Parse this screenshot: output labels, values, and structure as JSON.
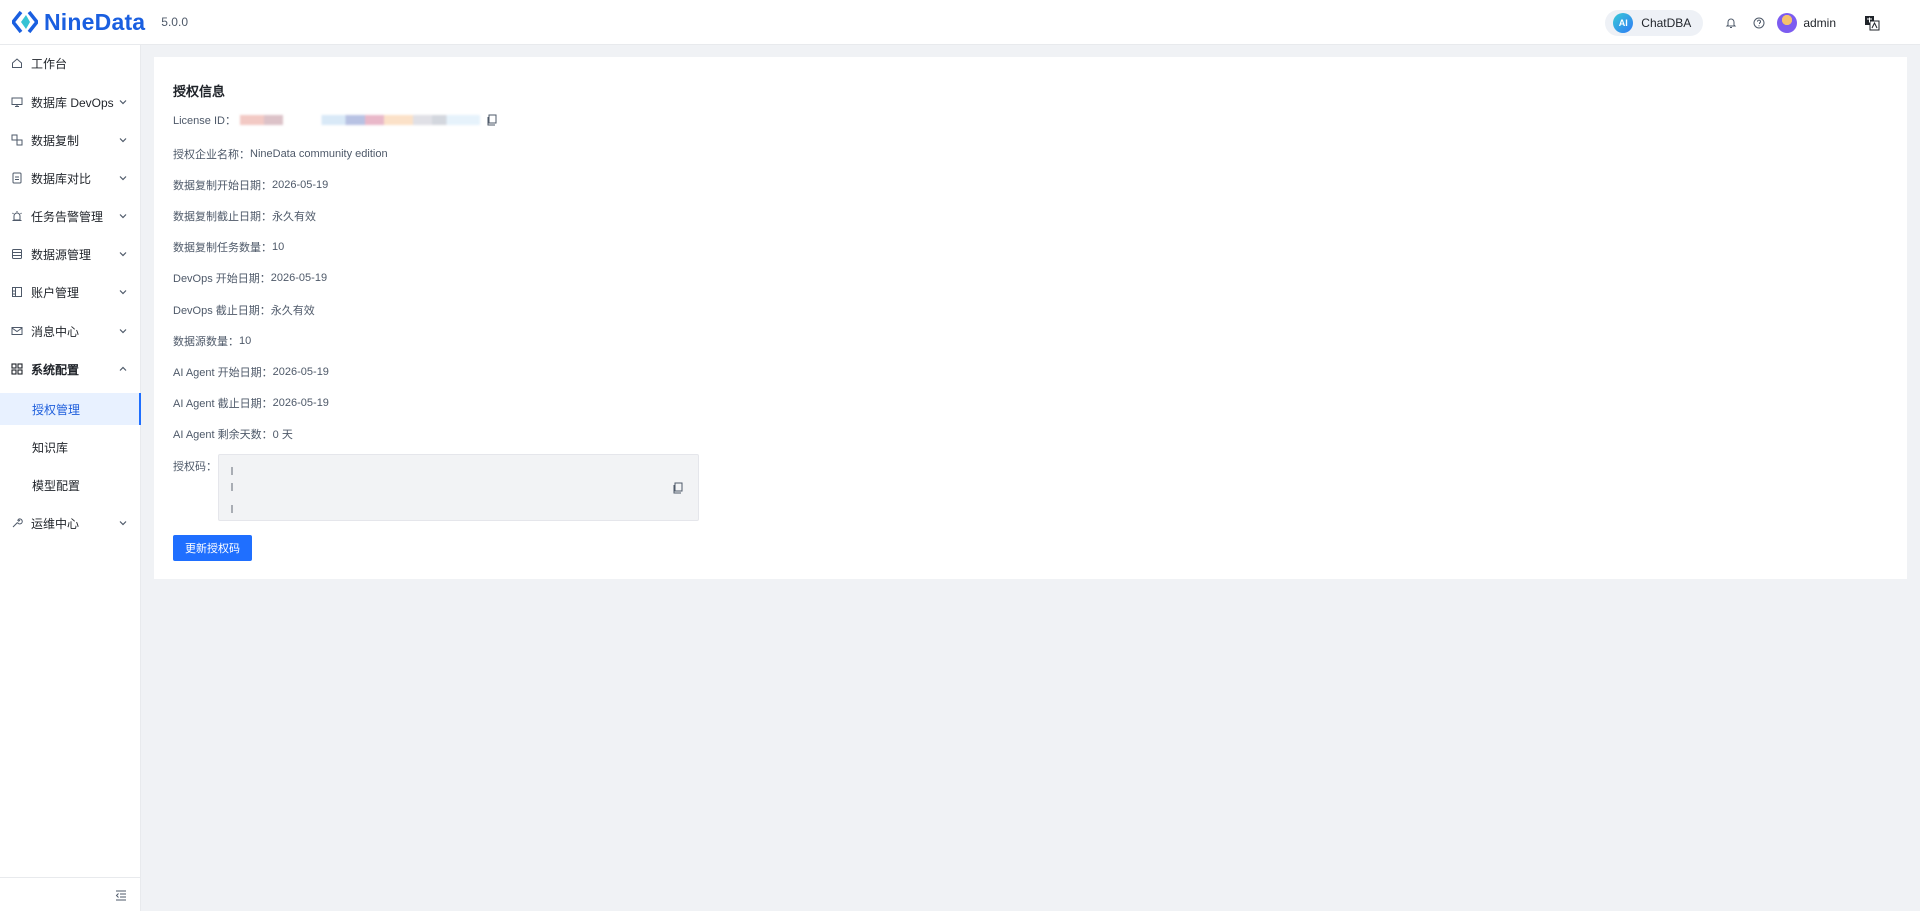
{
  "brand": {
    "name": "NineData",
    "version": "5.0.0",
    "color": "#1a5fe0"
  },
  "header": {
    "chatdba": {
      "badge": "AI",
      "label": "ChatDBA"
    },
    "user_name": "admin",
    "icons": [
      "bell-icon",
      "help-icon",
      "language-icon"
    ]
  },
  "sidebar": {
    "items": [
      {
        "label": "工作台",
        "icon": "home-icon",
        "expandable": false
      },
      {
        "label": "数据库 DevOps",
        "icon": "monitor-icon",
        "expandable": true
      },
      {
        "label": "数据复制",
        "icon": "replicate-icon",
        "expandable": true
      },
      {
        "label": "数据库对比",
        "icon": "compare-icon",
        "expandable": true
      },
      {
        "label": "任务告警管理",
        "icon": "alarm-icon",
        "expandable": true
      },
      {
        "label": "数据源管理",
        "icon": "database-icon",
        "expandable": true
      },
      {
        "label": "账户管理",
        "icon": "account-icon",
        "expandable": true
      },
      {
        "label": "消息中心",
        "icon": "mail-icon",
        "expandable": true
      },
      {
        "label": "系统配置",
        "icon": "grid-icon",
        "expandable": true,
        "expanded": true
      },
      {
        "label": "运维中心",
        "icon": "wrench-icon",
        "expandable": true
      }
    ],
    "sub_items": [
      {
        "label": "授权管理",
        "active": true
      },
      {
        "label": "知识库",
        "active": false
      },
      {
        "label": "模型配置",
        "active": false
      }
    ]
  },
  "license": {
    "title": "授权信息",
    "license_id_label": "License ID：",
    "rows": [
      {
        "label": "授权企业名称：",
        "value": "NineData community edition"
      },
      {
        "label": "数据复制开始日期：",
        "value": "2026-05-19"
      },
      {
        "label": "数据复制截止日期：",
        "value": "永久有效"
      },
      {
        "label": "数据复制任务数量：",
        "value": "10"
      },
      {
        "label": "DevOps 开始日期：",
        "value": "2026-05-19"
      },
      {
        "label": "DevOps 截止日期：",
        "value": "永久有效"
      },
      {
        "label": "数据源数量：",
        "value": "10"
      },
      {
        "label": "AI Agent 开始日期：",
        "value": "2026-05-19"
      },
      {
        "label": "AI Agent 截止日期：",
        "value": "2026-05-19"
      },
      {
        "label": "AI Agent 剩余天数：",
        "value": "0 天"
      }
    ],
    "code_label": "授权码：",
    "update_button": "更新授权码"
  },
  "colors": {
    "primary": "#1f6fff",
    "active_bg": "#e8f1ff",
    "page_bg": "#f0f2f5"
  }
}
